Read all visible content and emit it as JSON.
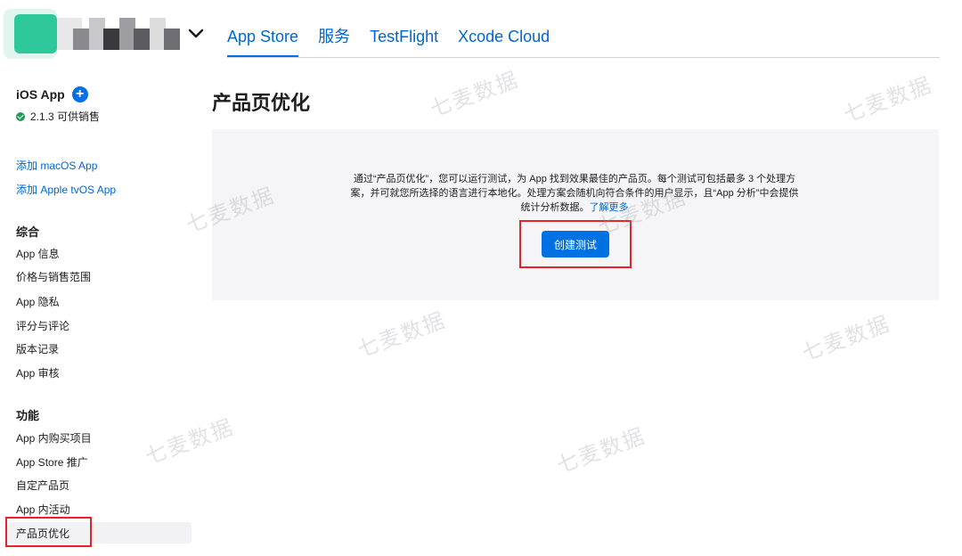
{
  "top_nav": {
    "tabs": [
      {
        "label": "App Store",
        "active": true
      },
      {
        "label": "服务",
        "active": false
      },
      {
        "label": "TestFlight",
        "active": false
      },
      {
        "label": "Xcode Cloud",
        "active": false
      }
    ]
  },
  "sidebar": {
    "app_title": "iOS App",
    "version_status": "2.1.3 可供销售",
    "add_links": [
      "添加 macOS App",
      "添加 Apple tvOS App"
    ],
    "sections": [
      {
        "header": "综合",
        "items": [
          "App 信息",
          "价格与销售范围",
          "App 隐私",
          "评分与评论",
          "版本记录",
          "App 审核"
        ]
      },
      {
        "header": "功能",
        "items": [
          "App 内购买项目",
          "App Store 推广",
          "自定产品页",
          "App 内活动",
          "产品页优化"
        ]
      }
    ],
    "selected_item": "产品页优化"
  },
  "main": {
    "title": "产品页优化",
    "description_line1": "通过“产品页优化”，您可以运行测试，为 App 找到效果最佳的产品页。每个测试可包括最多 3 个处理方",
    "description_line2": "案，并可就您所选择的语言进行本地化。处理方案会随机向符合条件的用户显示，且“App 分析”中会提供",
    "description_line3": "统计分析数据。",
    "learn_more": "了解更多",
    "create_button": "创建测试"
  },
  "watermark_text": "七麦数据",
  "colors": {
    "accent": "#0071e3",
    "link": "#0066cc",
    "panel_bg": "#f5f5f7",
    "highlight_box": "#e3242b",
    "status_green": "#1f9d55"
  }
}
